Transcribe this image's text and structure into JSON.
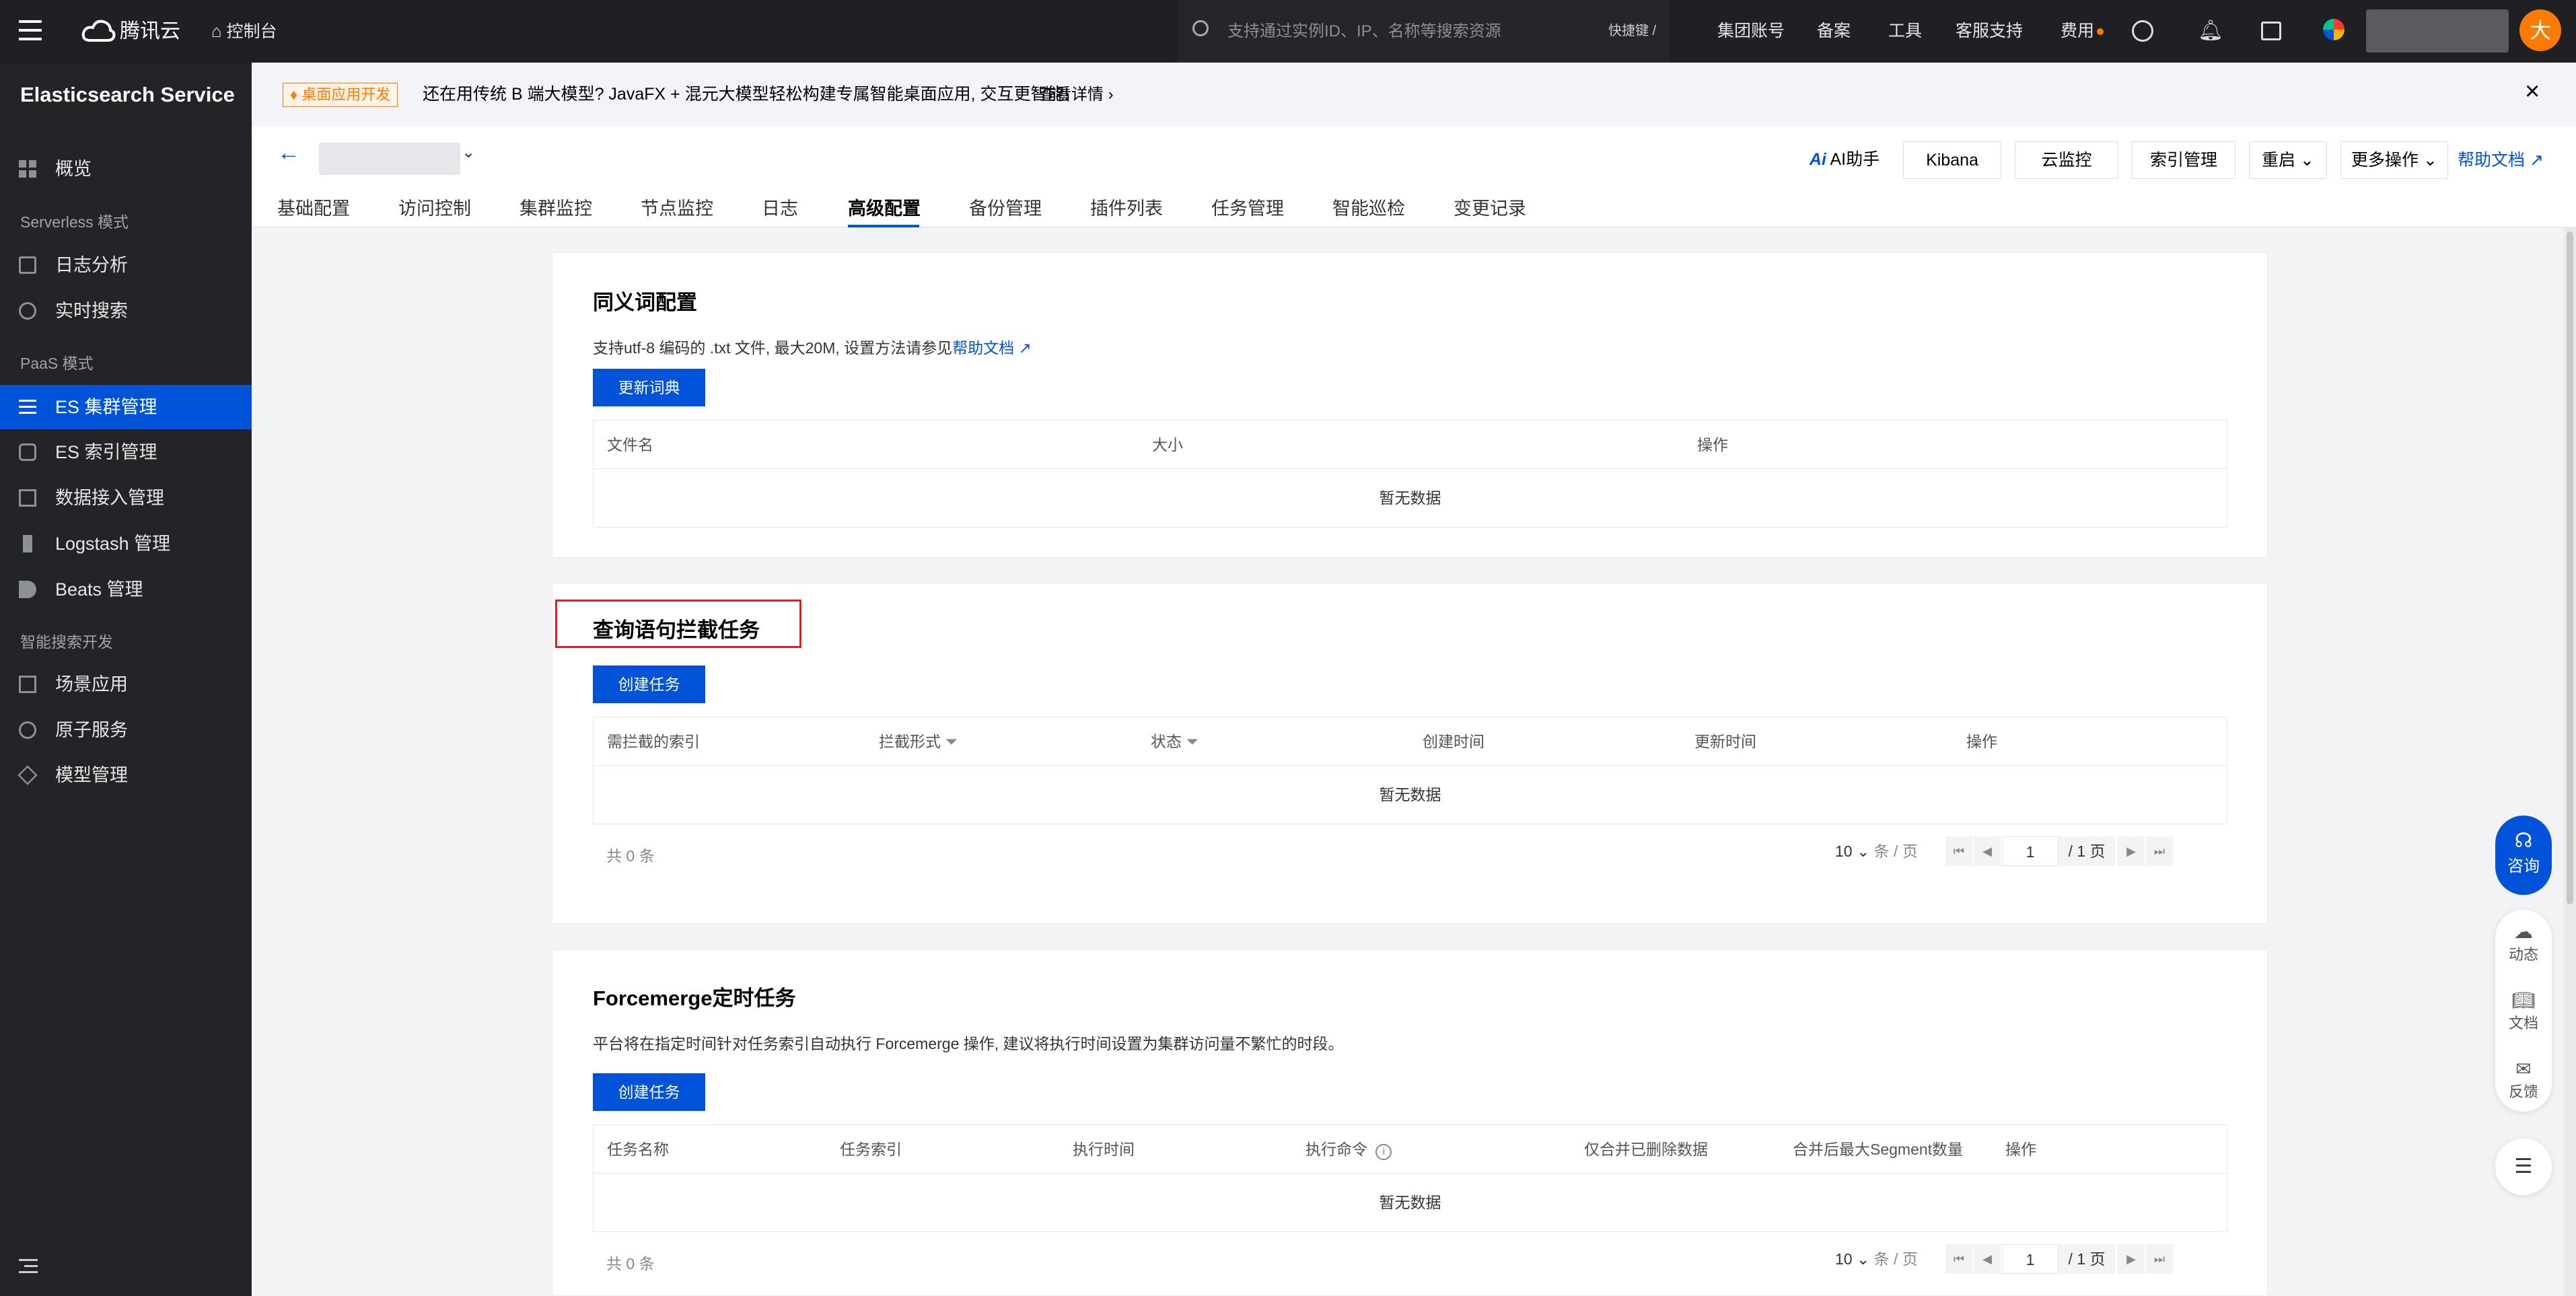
{
  "topbar": {
    "brand": "腾讯云",
    "console": "控制台",
    "search_placeholder": "支持通过实例ID、IP、名称等搜索资源",
    "shortcut": "快捷键 /",
    "menu": [
      "集团账号",
      "备案",
      "工具",
      "客服支持",
      "费用"
    ],
    "avatar_letter": "大"
  },
  "sidebar": {
    "title": "Elasticsearch Service",
    "overview": "概览",
    "group_serverless": "Serverless 模式",
    "log_analysis": "日志分析",
    "realtime_search": "实时搜索",
    "group_paas": "PaaS 模式",
    "es_cluster": "ES 集群管理",
    "es_index": "ES 索引管理",
    "data_ingest": "数据接入管理",
    "logstash": "Logstash 管理",
    "beats": "Beats 管理",
    "group_ai": "智能搜索开发",
    "scene_app": "场景应用",
    "atomic_service": "原子服务",
    "model_mgmt": "模型管理"
  },
  "notice": {
    "tag": "桌面应用开发",
    "text": "还在用传统 B 端大模型? JavaFX + 混元大模型轻松构建专属智能桌面应用, 交互更智能!",
    "link": "查看详情"
  },
  "header": {
    "ai_assistant": "AI助手",
    "kibana": "Kibana",
    "cloud_monitor": "云监控",
    "index_mgmt": "索引管理",
    "restart": "重启",
    "more_ops": "更多操作",
    "help_doc": "帮助文档",
    "tabs": [
      "基础配置",
      "访问控制",
      "集群监控",
      "节点监控",
      "日志",
      "高级配置",
      "备份管理",
      "插件列表",
      "任务管理",
      "智能巡检",
      "变更记录"
    ]
  },
  "synonym": {
    "title": "同义词配置",
    "desc": "支持utf-8 编码的 .txt 文件, 最大20M, 设置方法请参见",
    "desc_link": "帮助文档",
    "button": "更新词典",
    "columns": [
      "文件名",
      "大小",
      "操作"
    ],
    "empty": "暂无数据"
  },
  "query_block": {
    "title": "查询语句拦截任务",
    "button": "创建任务",
    "columns": [
      "需拦截的索引",
      "拦截形式",
      "状态",
      "创建时间",
      "更新时间",
      "操作"
    ],
    "empty": "暂无数据",
    "total": "共 0 条",
    "page_size": "10",
    "page_size_unit": "条 / 页",
    "page": "1",
    "page_total": "/ 1 页"
  },
  "forcemerge": {
    "title": "Forcemerge定时任务",
    "desc": "平台将在指定时间针对任务索引自动执行 Forcemerge 操作, 建议将执行时间设置为集群访问量不繁忙的时段。",
    "button": "创建任务",
    "columns": [
      "任务名称",
      "任务索引",
      "执行时间",
      "执行命令",
      "仅合并已删除数据",
      "合并后最大Segment数量",
      "操作"
    ],
    "empty": "暂无数据",
    "total": "共 0 条",
    "page_size": "10",
    "page_size_unit": "条 / 页",
    "page": "1",
    "page_total": "/ 1 页"
  },
  "float": {
    "consult": "咨询",
    "dynamic": "动态",
    "docs": "文档",
    "feedback": "反馈"
  },
  "colors": {
    "primary": "#0052d9",
    "topbar": "#1f2024",
    "sidebar": "#232428",
    "highlight_box": "#e02020",
    "avatar": "#ff7a00"
  }
}
